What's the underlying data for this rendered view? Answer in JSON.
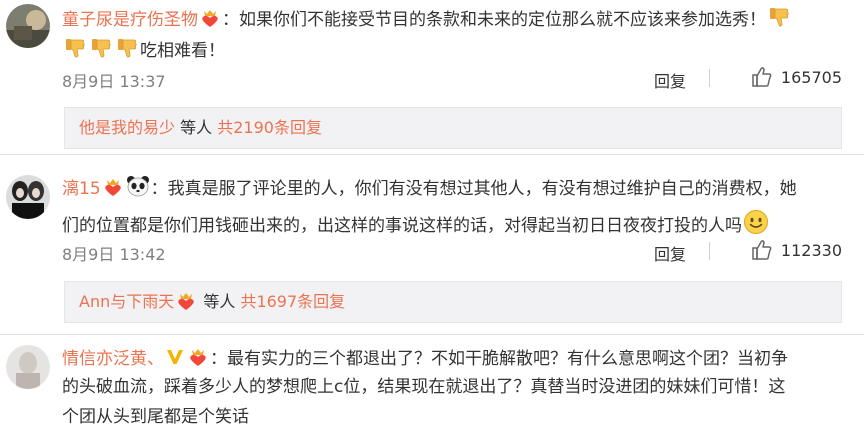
{
  "comments": [
    {
      "username": "童子尿是疗伤圣物",
      "text_line1": "：如果你们不能接受节目的条款和未来的定位那么就不应该来参加选秀！",
      "text_line2": "吃相难看！",
      "time": "8月9日 13:37",
      "reply_label": "回复",
      "like_count": "165705",
      "replies_link_user": "他是我的易少",
      "replies_mid": "等人",
      "replies_count_text": "共2190条回复"
    },
    {
      "username": "漓15",
      "text_line1": "：我真是服了评论里的人，你们有没有想过其他人，有没有想过维护自己的消费权，她",
      "text_line2": "们的位置都是你们用钱砸出来的，出这样的事说这样的话，对得起当初日日夜夜打投的人吗",
      "time": "8月9日 13:42",
      "reply_label": "回复",
      "like_count": "112330",
      "replies_link_user": "Ann与下雨天",
      "replies_mid": "等人",
      "replies_count_text": "共1697条回复"
    },
    {
      "username": "情信亦泛黄、",
      "text_line1": "：最有实力的三个都退出了？不如干脆解散吧？有什么意思啊这个团？当初争",
      "text_line2": "的头破血流，踩着多少人的梦想爬上c位，结果现在就退出了？真替当时没进团的妹妹们可惜！这",
      "text_line3": "个团从头到尾都是个笑话"
    }
  ],
  "icons": {
    "vip_badge": "vip-heart-crown-icon",
    "thumbs_down": "thumbs-down-emoji",
    "panda": "panda-emoji",
    "smile": "smile-emoji",
    "verified": "verified-v-icon",
    "like": "thumbs-up-icon"
  },
  "colors": {
    "username": "#eb7350",
    "meta": "#808080",
    "reply_box_bg": "#f2f2f5"
  }
}
